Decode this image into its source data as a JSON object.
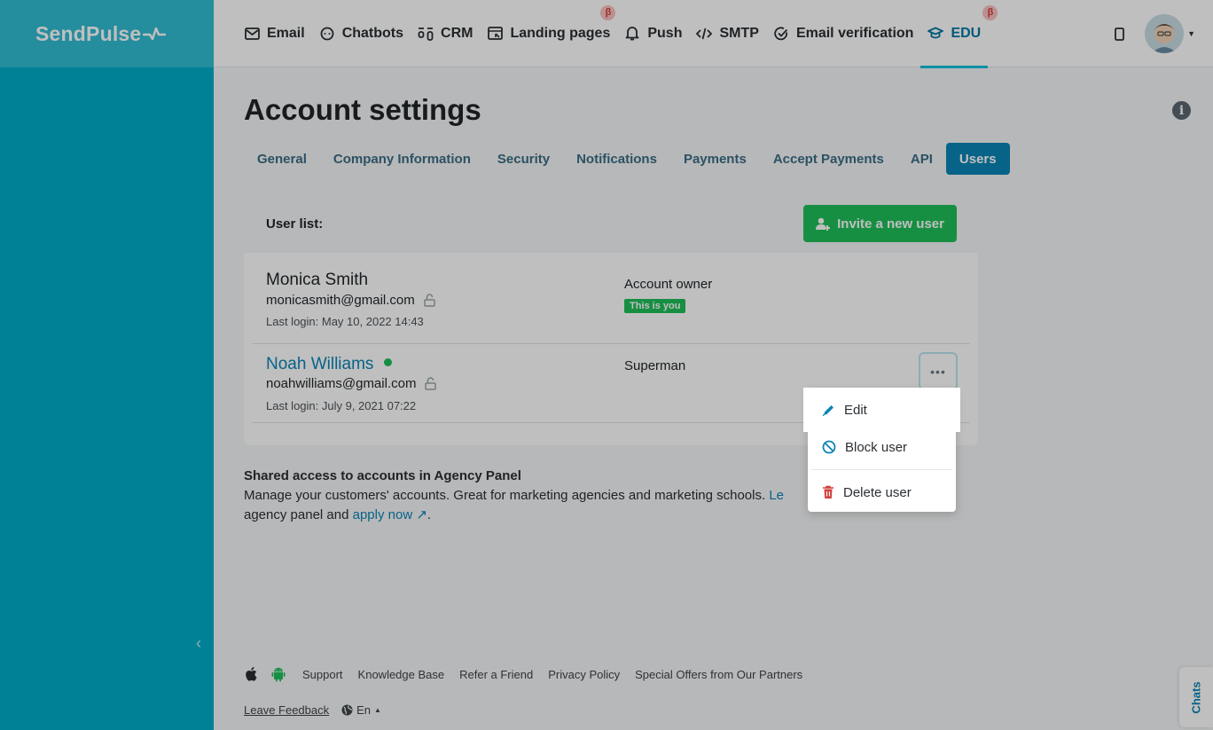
{
  "brand": {
    "name": "SendPulse"
  },
  "nav": {
    "items": [
      {
        "label": "Email",
        "icon": "envelope-icon"
      },
      {
        "label": "Chatbots",
        "icon": "chat-bubble-icon"
      },
      {
        "label": "CRM",
        "icon": "crm-icon"
      },
      {
        "label": "Landing pages",
        "icon": "landing-page-icon",
        "badge": "β"
      },
      {
        "label": "Push",
        "icon": "bell-icon"
      },
      {
        "label": "SMTP",
        "icon": "code-icon"
      },
      {
        "label": "Email verification",
        "icon": "check-circle-icon"
      },
      {
        "label": "EDU",
        "icon": "graduation-cap-icon",
        "badge": "β",
        "active": true
      }
    ]
  },
  "page": {
    "title": "Account settings"
  },
  "tabs": [
    {
      "label": "General"
    },
    {
      "label": "Company Information"
    },
    {
      "label": "Security"
    },
    {
      "label": "Notifications"
    },
    {
      "label": "Payments"
    },
    {
      "label": "Accept Payments"
    },
    {
      "label": "API"
    },
    {
      "label": "Users",
      "active": true
    }
  ],
  "users_card": {
    "list_label": "User list:",
    "invite_label": "Invite a new user",
    "users": [
      {
        "name": "Monica Smith",
        "email": "monicasmith@gmail.com",
        "last_login": "Last login: May 10, 2022 14:43",
        "role": "Account owner",
        "badge": "This is you"
      },
      {
        "name": "Noah Williams",
        "email": "noahwilliams@gmail.com",
        "last_login": "Last login: July 9, 2021 07:22",
        "role": "Superman",
        "online": true
      }
    ]
  },
  "row_menu": {
    "more_label": "•••",
    "items": [
      {
        "label": "Edit",
        "icon": "pencil-icon"
      },
      {
        "label": "Block user",
        "icon": "block-icon"
      },
      {
        "label": "Delete user",
        "icon": "trash-icon"
      }
    ]
  },
  "shared_access": {
    "title": "Shared access to accounts in Agency Panel",
    "text": "Manage your customers' accounts. Great for marketing agencies and marketing schools.",
    "link_partial": "Le",
    "line2_prefix": "agency panel and",
    "apply_link": "apply now"
  },
  "footer": {
    "links": [
      "Support",
      "Knowledge Base",
      "Refer a Friend",
      "Privacy Policy",
      "Special Offers from Our Partners"
    ],
    "feedback": "Leave Feedback",
    "language": "En"
  },
  "chats_tab": {
    "label": "Chats"
  },
  "colors": {
    "sidebar": "#00acc8",
    "accent": "#0a85b6",
    "success": "#1fbf5a",
    "beta_badge": "#f8c1c0",
    "danger": "#d23f3a"
  }
}
